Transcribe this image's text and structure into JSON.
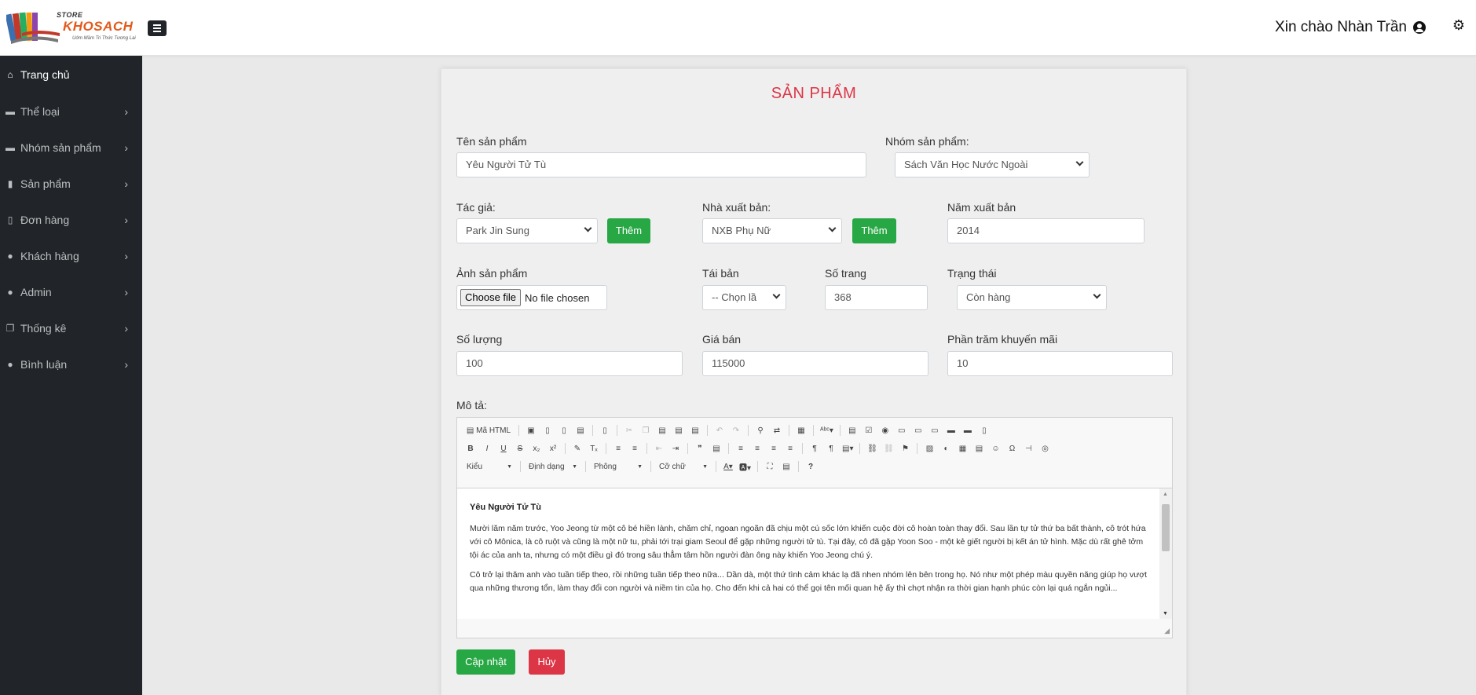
{
  "header": {
    "logo": {
      "store": "STORE",
      "brand": "KHOSACH",
      "slogan": "Uớm Mầm Tri Thức Tương Lai"
    },
    "greeting": "Xin chào Nhàn Trần"
  },
  "sidebar": {
    "items": [
      {
        "label": "Trang chủ",
        "icon": "home-icon"
      },
      {
        "label": "Thể loại",
        "icon": "folder-icon"
      },
      {
        "label": "Nhóm sản phẩm",
        "icon": "folder-icon"
      },
      {
        "label": "Sản phẩm",
        "icon": "book-icon"
      },
      {
        "label": "Đơn hàng",
        "icon": "file-icon"
      },
      {
        "label": "Khách hàng",
        "icon": "users-icon"
      },
      {
        "label": "Admin",
        "icon": "user-icon"
      },
      {
        "label": "Thống kê",
        "icon": "copy-icon"
      },
      {
        "label": "Bình luận",
        "icon": "comment-icon"
      }
    ]
  },
  "form": {
    "title": "SẢN PHẨM",
    "name_label": "Tên sản phẩm",
    "name_value": "Yêu Người Tử Tù",
    "group_label": "Nhóm sản phẩm:",
    "group_value": "Sách Văn Học Nước Ngoài",
    "author_label": "Tác giả:",
    "author_value": "Park Jin Sung",
    "add_label": "Thêm",
    "publisher_label": "Nhà xuất bản:",
    "publisher_value": "NXB Phụ Nữ",
    "year_label": "Năm xuất bản",
    "year_value": "2014",
    "image_label": "Ảnh sản phẩm",
    "file_button": "Choose file",
    "file_text": "No file chosen",
    "reprint_label": "Tái bản",
    "reprint_value": "-- Chọn lầ",
    "pages_label": "Số trang",
    "pages_value": "368",
    "status_label": "Trạng thái",
    "status_value": "Còn hàng",
    "qty_label": "Số lượng",
    "qty_value": "100",
    "price_label": "Giá bán",
    "price_value": "115000",
    "discount_label": "Phần trăm khuyến mãi",
    "discount_value": "10",
    "desc_label": "Mô tả:",
    "update_label": "Cập nhật",
    "cancel_label": "Hủy"
  },
  "editor": {
    "source_label": "Mã HTML",
    "combos": {
      "style": "Kiểu",
      "format": "Định dạng",
      "font": "Phông",
      "size": "Cỡ chữ"
    },
    "content_title": "Yêu Người Tử Tù",
    "para1": "Mười lăm năm trước, Yoo Jeong từ một cô bé hiền lành, chăm chỉ, ngoan ngoãn đã chịu một cú sốc lớn khiến cuộc đời cô hoàn toàn thay đổi. Sau lần tự tử thứ ba bất thành, cô trót hứa với cô Mônica, là cô ruột và cũng là một nữ tu, phải tới trại giam Seoul để gặp những người tử tù. Tại đây, cô đã gặp Yoon Soo - một kẻ giết người bị kết án tử hình. Mặc dù rất ghê tởm tội ác của anh ta, nhưng có một điều gì đó trong sâu thẳm tâm hồn người đàn ông này khiến Yoo Jeong chú ý.",
    "para2": "Cô trở lại thăm anh vào tuần tiếp theo, rồi những tuần tiếp theo nữa... Dần dà, một thứ tình cảm khác lạ đã nhen nhóm lên bên trong họ. Nó như một phép màu quyền năng giúp họ vượt qua những thương tổn, làm thay đổi con người và niềm tin của họ. Cho đến khi cả hai có thể gọi tên mối quan hệ ấy thì chợt nhận ra thời gian hạnh phúc còn lại quá ngắn ngủi..."
  },
  "colors": {
    "sidebar_bg": "#212529",
    "title_red": "#dc3545",
    "green": "#28a745",
    "brand_orange": "#e25a1c"
  }
}
